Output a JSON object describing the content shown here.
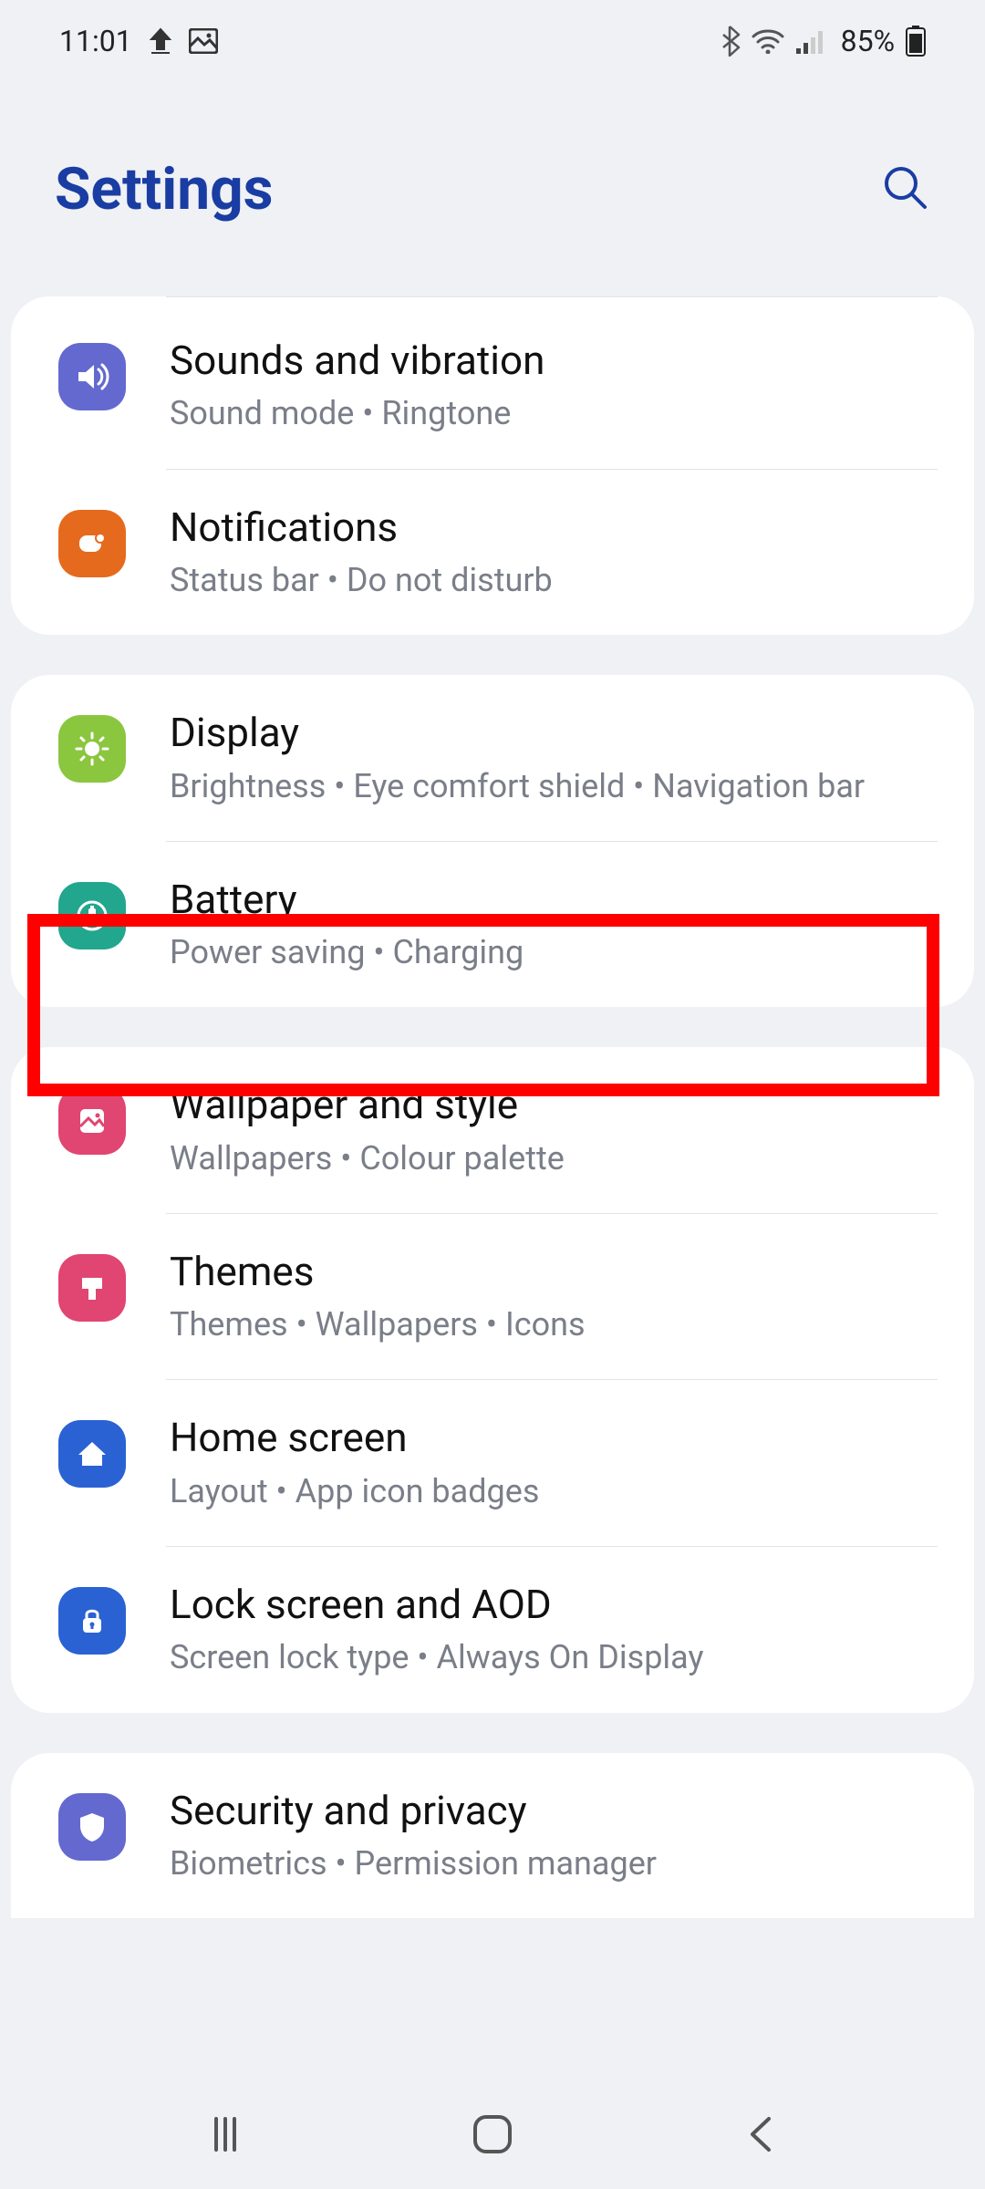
{
  "status": {
    "time": "11:01",
    "battery": "85%"
  },
  "header": {
    "title": "Settings"
  },
  "groups": [
    {
      "items": [
        {
          "id": "sounds",
          "title": "Sounds and vibration",
          "sub": "Sound mode  •  Ringtone",
          "color": "#6469d0"
        },
        {
          "id": "notifications",
          "title": "Notifications",
          "sub": "Status bar  •  Do not disturb",
          "color": "#e56a1e"
        }
      ]
    },
    {
      "items": [
        {
          "id": "display",
          "title": "Display",
          "sub": "Brightness  •  Eye comfort shield  •  Navigation bar",
          "color": "#8bc63f"
        },
        {
          "id": "battery",
          "title": "Battery",
          "sub": "Power saving  •  Charging",
          "color": "#22a68e"
        }
      ]
    },
    {
      "items": [
        {
          "id": "wallpaper",
          "title": "Wallpaper and style",
          "sub": "Wallpapers  •  Colour palette",
          "color": "#e14571"
        },
        {
          "id": "themes",
          "title": "Themes",
          "sub": "Themes  •  Wallpapers  •  Icons",
          "color": "#e14571"
        },
        {
          "id": "home",
          "title": "Home screen",
          "sub": "Layout  •  App icon badges",
          "color": "#2a62d4"
        },
        {
          "id": "lock",
          "title": "Lock screen and AOD",
          "sub": "Screen lock type  •  Always On Display",
          "color": "#2a62d4"
        }
      ]
    },
    {
      "items": [
        {
          "id": "security",
          "title": "Security and privacy",
          "sub": "Biometrics  •  Permission manager",
          "color": "#6469d0"
        }
      ]
    }
  ]
}
